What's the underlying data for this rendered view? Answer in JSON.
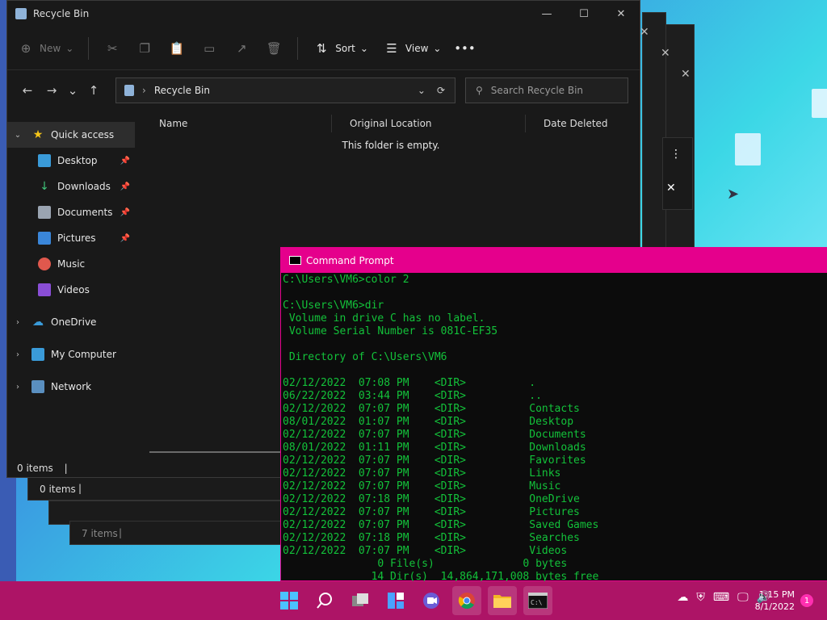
{
  "explorer": {
    "title": "Recycle Bin",
    "toolbar": {
      "new_label": "New",
      "sort_label": "Sort",
      "view_label": "View"
    },
    "address": "Recycle Bin",
    "search_placeholder": "Search Recycle Bin",
    "sidebar": {
      "quick_access": "Quick access",
      "items": [
        "Desktop",
        "Downloads",
        "Documents",
        "Pictures",
        "Music",
        "Videos"
      ],
      "onedrive": "OneDrive",
      "my_computer": "My Computer",
      "network": "Network"
    },
    "columns": [
      "Name",
      "Original Location",
      "Date Deleted"
    ],
    "empty_text": "This folder is empty.",
    "status": "0 items"
  },
  "background_windows": {
    "status1": "0 items",
    "status2": "7 items"
  },
  "cmd": {
    "title": "Command Prompt",
    "lines": [
      "C:\\Users\\VM6>color 2",
      "",
      "C:\\Users\\VM6>dir",
      " Volume in drive C has no label.",
      " Volume Serial Number is 081C-EF35",
      "",
      " Directory of C:\\Users\\VM6",
      "",
      "02/12/2022  07:08 PM    <DIR>          .",
      "06/22/2022  03:44 PM    <DIR>          ..",
      "02/12/2022  07:07 PM    <DIR>          Contacts",
      "08/01/2022  01:07 PM    <DIR>          Desktop",
      "02/12/2022  07:07 PM    <DIR>          Documents",
      "08/01/2022  01:11 PM    <DIR>          Downloads",
      "02/12/2022  07:07 PM    <DIR>          Favorites",
      "02/12/2022  07:07 PM    <DIR>          Links",
      "02/12/2022  07:07 PM    <DIR>          Music",
      "02/12/2022  07:18 PM    <DIR>          OneDrive",
      "02/12/2022  07:07 PM    <DIR>          Pictures",
      "02/12/2022  07:07 PM    <DIR>          Saved Games",
      "02/12/2022  07:18 PM    <DIR>          Searches",
      "02/12/2022  07:07 PM    <DIR>          Videos",
      "               0 File(s)              0 bytes",
      "              14 Dir(s)  14,864,171,008 bytes free"
    ]
  },
  "taskbar": {
    "time": "1:15 PM",
    "date": "8/1/2022",
    "notifications": "1"
  },
  "colors": {
    "cmd_accent": "#e5008c",
    "cmd_text": "#13c23a",
    "taskbar": "#ad1466"
  }
}
